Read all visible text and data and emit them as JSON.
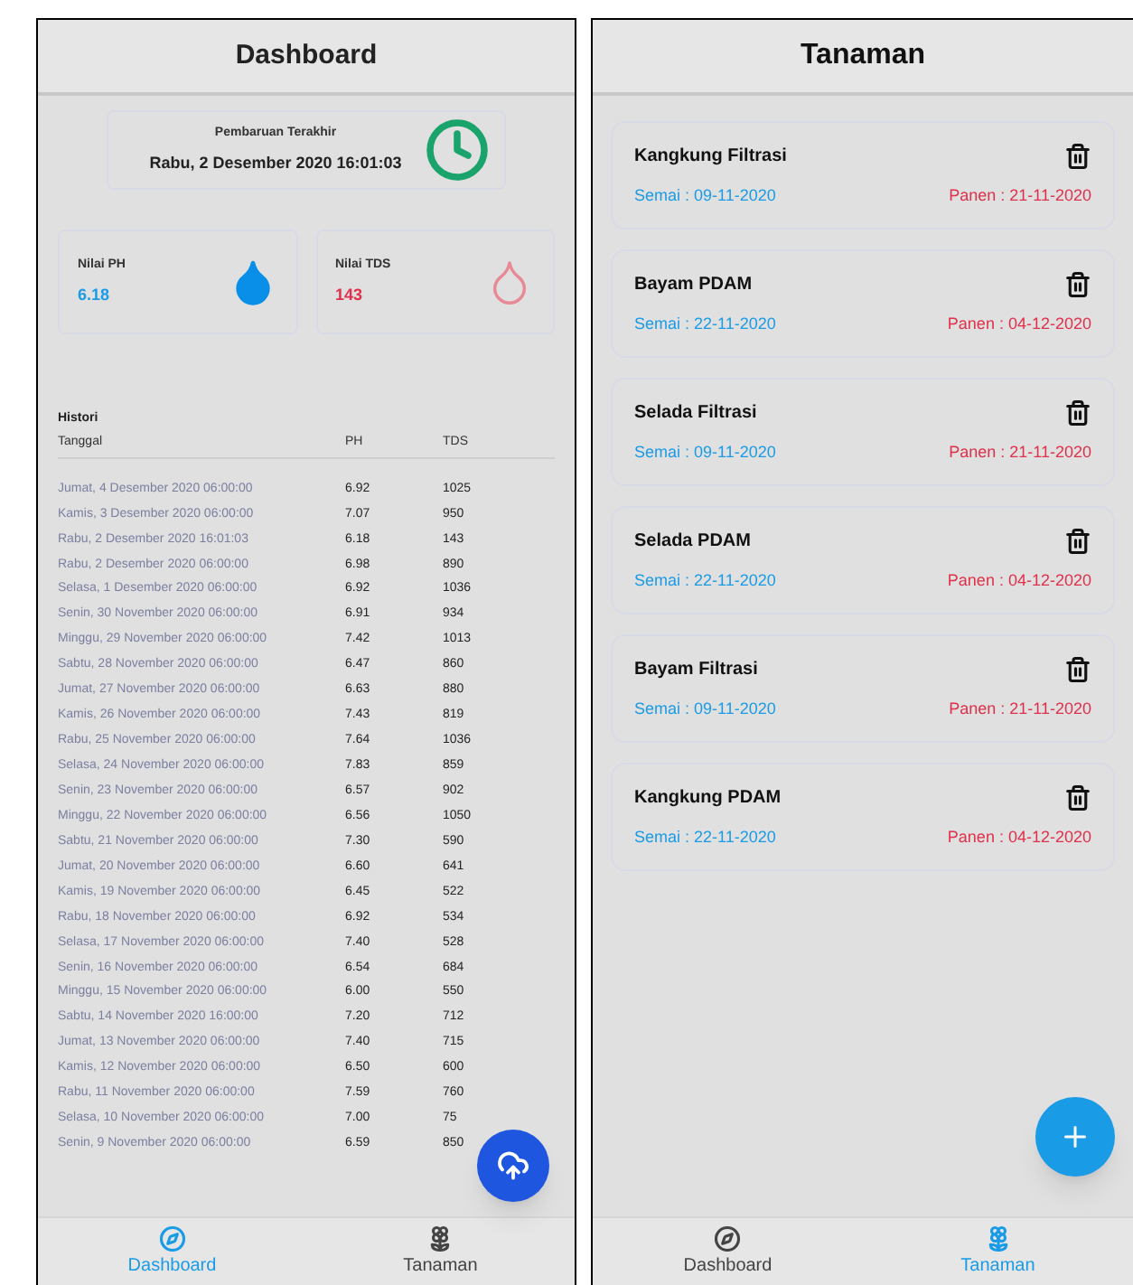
{
  "dashboard": {
    "title": "Dashboard",
    "last_update": {
      "label": "Pembaruan Terakhir",
      "value": "Rabu, 2 Desember 2020 16:01:03"
    },
    "ph": {
      "label": "Nilai PH",
      "value": "6.18"
    },
    "tds": {
      "label": "Nilai TDS",
      "value": "143"
    },
    "history": {
      "title": "Histori",
      "columns": [
        "Tanggal",
        "PH",
        "TDS"
      ],
      "rows": [
        {
          "date": "Jumat, 4 Desember 2020 06:00:00",
          "ph": "6.92",
          "tds": "1025"
        },
        {
          "date": "Kamis, 3 Desember 2020 06:00:00",
          "ph": "7.07",
          "tds": "950"
        },
        {
          "date": "Rabu, 2 Desember 2020 16:01:03",
          "ph": "6.18",
          "tds": "143"
        },
        {
          "date": "Rabu, 2 Desember 2020 06:00:00",
          "ph": "6.98",
          "tds": "890"
        },
        {
          "date": "Selasa, 1 Desember 2020 06:00:00",
          "ph": "6.92",
          "tds": "1036"
        },
        {
          "date": "Senin, 30 November 2020 06:00:00",
          "ph": "6.91",
          "tds": "934"
        },
        {
          "date": "Minggu, 29 November 2020 06:00:00",
          "ph": "7.42",
          "tds": "1013"
        },
        {
          "date": "Sabtu, 28 November 2020 06:00:00",
          "ph": "6.47",
          "tds": "860"
        },
        {
          "date": "Jumat, 27 November 2020 06:00:00",
          "ph": "6.63",
          "tds": "880"
        },
        {
          "date": "Kamis, 26 November 2020 06:00:00",
          "ph": "7.43",
          "tds": "819"
        },
        {
          "date": "Rabu, 25 November 2020 06:00:00",
          "ph": "7.64",
          "tds": "1036"
        },
        {
          "date": "Selasa, 24 November 2020 06:00:00",
          "ph": "7.83",
          "tds": "859"
        },
        {
          "date": "Senin, 23 November 2020 06:00:00",
          "ph": "6.57",
          "tds": "902"
        },
        {
          "date": "Minggu, 22 November 2020 06:00:00",
          "ph": "6.56",
          "tds": "1050"
        },
        {
          "date": "Sabtu, 21 November 2020 06:00:00",
          "ph": "7.30",
          "tds": "590"
        },
        {
          "date": "Jumat, 20 November 2020 06:00:00",
          "ph": "6.60",
          "tds": "641"
        },
        {
          "date": "Kamis, 19 November 2020 06:00:00",
          "ph": "6.45",
          "tds": "522"
        },
        {
          "date": "Rabu, 18 November 2020 06:00:00",
          "ph": "6.92",
          "tds": "534"
        },
        {
          "date": "Selasa, 17 November 2020 06:00:00",
          "ph": "7.40",
          "tds": "528"
        },
        {
          "date": "Senin, 16 November 2020 06:00:00",
          "ph": "6.54",
          "tds": "684"
        },
        {
          "date": "Minggu, 15 November 2020 06:00:00",
          "ph": "6.00",
          "tds": "550"
        },
        {
          "date": "Sabtu, 14 November 2020 16:00:00",
          "ph": "7.20",
          "tds": "712"
        },
        {
          "date": "Jumat, 13 November 2020 06:00:00",
          "ph": "7.40",
          "tds": "715"
        },
        {
          "date": "Kamis, 12 November 2020 06:00:00",
          "ph": "6.50",
          "tds": "600"
        },
        {
          "date": "Rabu, 11 November 2020 06:00:00",
          "ph": "7.59",
          "tds": "760"
        },
        {
          "date": "Selasa, 10 November 2020 06:00:00",
          "ph": "7.00",
          "tds": "75"
        },
        {
          "date": "Senin, 9 November 2020 06:00:00",
          "ph": "6.59",
          "tds": "850"
        }
      ]
    },
    "nav": [
      {
        "label": "Dashboard",
        "kind": "dashboard",
        "selected": true
      },
      {
        "label": "Tanaman",
        "kind": "plant",
        "selected": false
      }
    ]
  },
  "tanaman": {
    "title": "Tanaman",
    "plants": [
      {
        "name": "Kangkung Filtrasi",
        "semai": "Semai : 09-11-2020",
        "panen": "Panen : 21-11-2020"
      },
      {
        "name": "Bayam PDAM",
        "semai": "Semai : 22-11-2020",
        "panen": "Panen : 04-12-2020"
      },
      {
        "name": "Selada Filtrasi",
        "semai": "Semai : 09-11-2020",
        "panen": "Panen : 21-11-2020"
      },
      {
        "name": "Selada PDAM",
        "semai": "Semai : 22-11-2020",
        "panen": "Panen : 04-12-2020"
      },
      {
        "name": "Bayam Filtrasi",
        "semai": "Semai : 09-11-2020",
        "panen": "Panen : 21-11-2020"
      },
      {
        "name": "Kangkung PDAM",
        "semai": "Semai : 22-11-2020",
        "panen": "Panen : 04-12-2020"
      }
    ],
    "nav": [
      {
        "label": "Dashboard",
        "kind": "dashboard",
        "selected": false
      },
      {
        "label": "Tanaman",
        "kind": "plant",
        "selected": true
      }
    ]
  }
}
